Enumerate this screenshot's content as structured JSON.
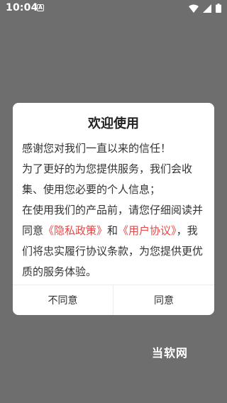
{
  "status_bar": {
    "time": "10:04",
    "notification_icon": "a-box-icon",
    "icons": [
      "wifi-icon",
      "signal-icon",
      "battery-icon"
    ]
  },
  "dialog": {
    "title": "欢迎使用",
    "line1": "感谢您对我们一直以来的信任！",
    "line2": "为了更好的为您提供服务，我们会收集、使用您必要的个人信息；",
    "line3_prefix": "在使用我们的产品前，请您仔细阅读并同意",
    "privacy_link": "《隐私政策》",
    "and_text": "和",
    "user_agreement_link": "《用户协议》",
    "line3_suffix": "，我们将忠实履行协议条款，为您提供更优质的服务体验。",
    "buttons": {
      "disagree": "不同意",
      "agree": "同意"
    },
    "colors": {
      "link": "#e54848",
      "overlay": "#6e6e6e"
    }
  },
  "watermark": "当软网"
}
